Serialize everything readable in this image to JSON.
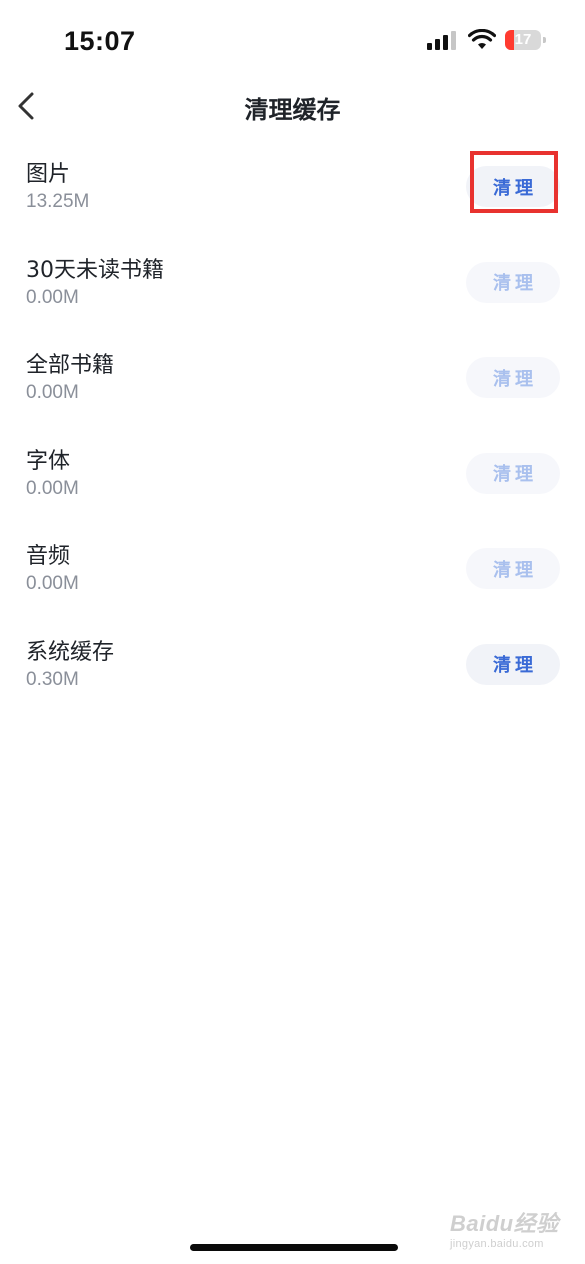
{
  "status_bar": {
    "time": "15:07",
    "battery_level": "17",
    "icons": [
      "signal-icon",
      "wifi-icon",
      "battery-icon"
    ]
  },
  "nav": {
    "title": "清理缓存",
    "back_icon": "chevron-left-icon"
  },
  "cache_items": [
    {
      "name": "图片",
      "size": "13.25M",
      "button_label": "清理",
      "enabled": true,
      "highlighted": true
    },
    {
      "name": "30天未读书籍",
      "size": "0.00M",
      "button_label": "清理",
      "enabled": false
    },
    {
      "name": "全部书籍",
      "size": "0.00M",
      "button_label": "清理",
      "enabled": false
    },
    {
      "name": "字体",
      "size": "0.00M",
      "button_label": "清理",
      "enabled": false
    },
    {
      "name": "音频",
      "size": "0.00M",
      "button_label": "清理",
      "enabled": false
    },
    {
      "name": "系统缓存",
      "size": "0.30M",
      "button_label": "清理",
      "enabled": true
    }
  ],
  "colors": {
    "accent": "#3a6ad6",
    "disabled_text": "#a9c0ee",
    "button_bg": "#f1f3f8",
    "highlight": "#e8322f",
    "battery_low": "#ff3b30"
  },
  "watermark": {
    "logo": "Baidu经验",
    "url": "jingyan.baidu.com"
  }
}
